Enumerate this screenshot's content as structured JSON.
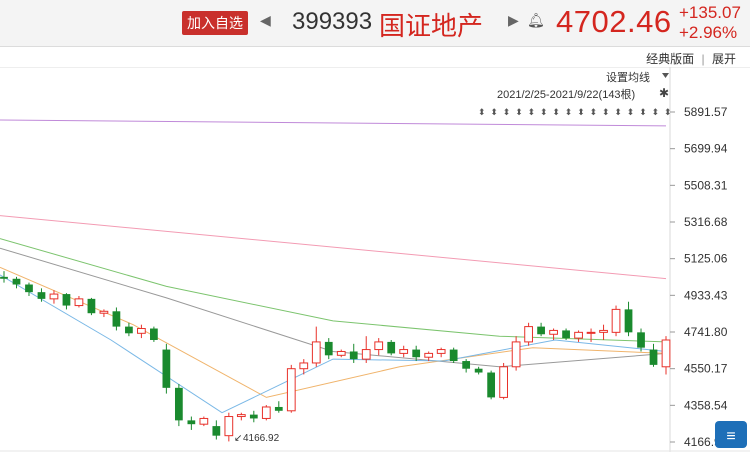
{
  "header": {
    "add_watchlist": "加入自选",
    "code": "399393",
    "name": "国证地产",
    "price": "4702.46",
    "change": "+135.07",
    "change_pct": "+2.96%"
  },
  "toolbar": {
    "classic": "经典版面",
    "separator": "|",
    "expand": "展开",
    "set_ma": "设置均线",
    "range": "2021/2/25-2021/9/22(143根)"
  },
  "colors": {
    "up": "#e8312a",
    "down": "#1a8a2e",
    "price_text": "#d4261f"
  },
  "chart_data": {
    "type": "candlestick",
    "ylim": [
      4166.92,
      5891.57
    ],
    "y_ticks": [
      "5891.57",
      "5699.94",
      "5508.31",
      "5316.68",
      "5125.06",
      "4933.43",
      "4741.80",
      "4550.17",
      "4358.54",
      "4166.92"
    ],
    "low_marker": "4166.92",
    "candles": [
      [
        5030,
        5060,
        5000,
        5020
      ],
      [
        5020,
        5030,
        4970,
        4990
      ],
      [
        4990,
        5000,
        4930,
        4950
      ],
      [
        4950,
        4970,
        4900,
        4915
      ],
      [
        4915,
        4960,
        4890,
        4940
      ],
      [
        4940,
        4945,
        4860,
        4880
      ],
      [
        4880,
        4930,
        4870,
        4915
      ],
      [
        4915,
        4920,
        4830,
        4840
      ],
      [
        4840,
        4860,
        4820,
        4850
      ],
      [
        4850,
        4870,
        4750,
        4770
      ],
      [
        4770,
        4790,
        4720,
        4735
      ],
      [
        4735,
        4780,
        4710,
        4760
      ],
      [
        4760,
        4770,
        4690,
        4700
      ],
      [
        4650,
        4680,
        4420,
        4450
      ],
      [
        4450,
        4470,
        4250,
        4280
      ],
      [
        4280,
        4300,
        4230,
        4260
      ],
      [
        4260,
        4300,
        4250,
        4290
      ],
      [
        4250,
        4280,
        4180,
        4200
      ],
      [
        4200,
        4320,
        4170,
        4300
      ],
      [
        4300,
        4320,
        4280,
        4310
      ],
      [
        4310,
        4330,
        4270,
        4290
      ],
      [
        4290,
        4360,
        4280,
        4350
      ],
      [
        4350,
        4380,
        4320,
        4330
      ],
      [
        4330,
        4570,
        4320,
        4550
      ],
      [
        4550,
        4600,
        4520,
        4580
      ],
      [
        4580,
        4770,
        4560,
        4690
      ],
      [
        4690,
        4710,
        4600,
        4620
      ],
      [
        4620,
        4650,
        4610,
        4640
      ],
      [
        4640,
        4680,
        4580,
        4600
      ],
      [
        4600,
        4720,
        4580,
        4650
      ],
      [
        4650,
        4710,
        4620,
        4690
      ],
      [
        4690,
        4700,
        4620,
        4630
      ],
      [
        4630,
        4670,
        4610,
        4650
      ],
      [
        4650,
        4670,
        4590,
        4610
      ],
      [
        4610,
        4640,
        4590,
        4630
      ],
      [
        4630,
        4660,
        4610,
        4650
      ],
      [
        4650,
        4660,
        4580,
        4590
      ],
      [
        4590,
        4600,
        4530,
        4550
      ],
      [
        4550,
        4560,
        4520,
        4530
      ],
      [
        4530,
        4540,
        4390,
        4400
      ],
      [
        4400,
        4580,
        4390,
        4560
      ],
      [
        4560,
        4720,
        4540,
        4690
      ],
      [
        4690,
        4790,
        4670,
        4770
      ],
      [
        4770,
        4790,
        4720,
        4730
      ],
      [
        4730,
        4760,
        4700,
        4750
      ],
      [
        4750,
        4760,
        4700,
        4710
      ],
      [
        4710,
        4750,
        4690,
        4740
      ],
      [
        4740,
        4760,
        4690,
        4740
      ],
      [
        4740,
        4780,
        4700,
        4750
      ],
      [
        4740,
        4880,
        4720,
        4860
      ],
      [
        4860,
        4900,
        4720,
        4740
      ],
      [
        4740,
        4760,
        4640,
        4660
      ],
      [
        4650,
        4680,
        4560,
        4570
      ],
      [
        4560,
        4720,
        4520,
        4700
      ]
    ],
    "ma_series": [
      {
        "color": "#c08ad9",
        "values": [
          5850,
          5819
        ]
      },
      {
        "color": "#f39bb3",
        "values": [
          5350,
          5021
        ]
      },
      {
        "color": "#7cc46e",
        "values": [
          5230,
          4980,
          4800,
          4720,
          4690
        ]
      },
      {
        "color": "#999999",
        "values": [
          5180,
          4920,
          4640,
          4560,
          4630
        ]
      },
      {
        "color": "#f0b46c",
        "values": [
          5080,
          4780,
          4400,
          4560,
          4660,
          4630
        ]
      },
      {
        "color": "#7ab8e6",
        "values": [
          5040,
          4700,
          4320,
          4600,
          4590,
          4700,
          4640
        ]
      }
    ]
  }
}
